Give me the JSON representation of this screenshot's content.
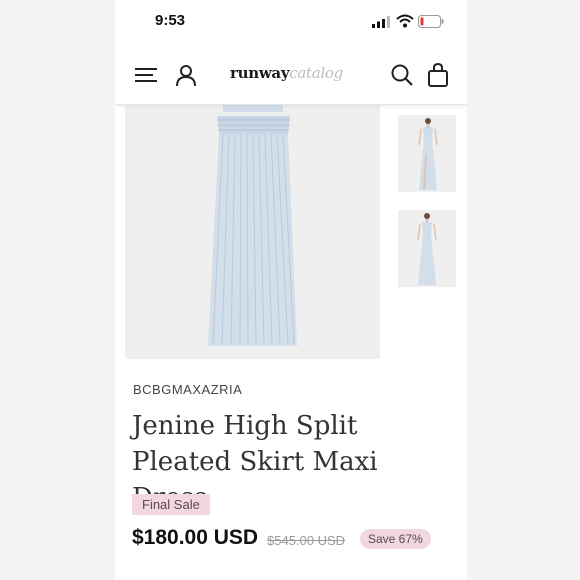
{
  "status_bar": {
    "time": "9:53"
  },
  "navbar": {
    "logo_bold": "runway",
    "logo_light": "catalog"
  },
  "product": {
    "brand": "BCBGMAXAZRIA",
    "title": "Jenine High Split Pleated Skirt Maxi Dress",
    "tag": "Final Sale",
    "price": "$180.00 USD",
    "original_price": "$545.00 USD",
    "discount": "Save 67%"
  },
  "colors": {
    "badge_bg": "#f2d7e3",
    "dress": "#cfdce9"
  }
}
